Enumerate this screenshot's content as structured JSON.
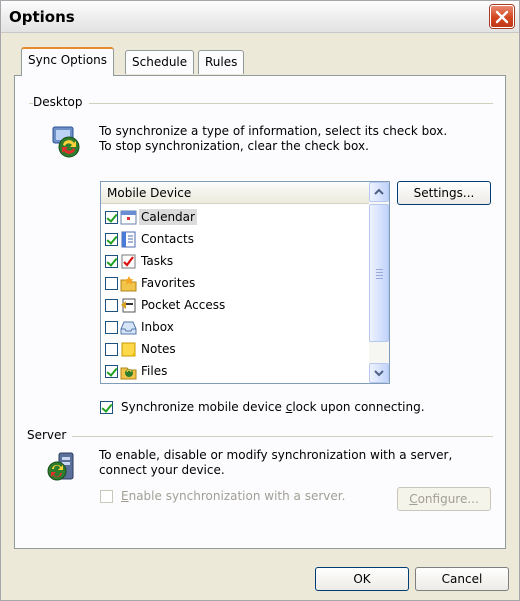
{
  "window": {
    "title": "Options"
  },
  "tabs": [
    {
      "label": "Sync Options",
      "active": true
    },
    {
      "label": "Schedule",
      "active": false
    },
    {
      "label": "Rules",
      "active": false
    }
  ],
  "desktop": {
    "group_label": "Desktop",
    "desc_line1": "To synchronize a type of information, select its check box.",
    "desc_line2": "To stop synchronization, clear the check box.",
    "list_header": "Mobile Device",
    "items": [
      {
        "label": "Calendar",
        "checked": true,
        "icon": "calendar-icon",
        "selected": true
      },
      {
        "label": "Contacts",
        "checked": true,
        "icon": "contacts-icon",
        "selected": false
      },
      {
        "label": "Tasks",
        "checked": true,
        "icon": "tasks-icon",
        "selected": false
      },
      {
        "label": "Favorites",
        "checked": false,
        "icon": "favorites-icon",
        "selected": false
      },
      {
        "label": "Pocket Access",
        "checked": false,
        "icon": "pocket-access-icon",
        "selected": false
      },
      {
        "label": "Inbox",
        "checked": false,
        "icon": "inbox-icon",
        "selected": false
      },
      {
        "label": "Notes",
        "checked": false,
        "icon": "notes-icon",
        "selected": false
      },
      {
        "label": "Files",
        "checked": true,
        "icon": "files-icon",
        "selected": false
      }
    ],
    "settings_button": "Settings...",
    "sync_clock_pre": "Synchronize mobile device ",
    "sync_clock_u": "c",
    "sync_clock_post": "lock upon connecting.",
    "sync_clock_checked": true
  },
  "server": {
    "group_label": "Server",
    "desc_line1": "To enable, disable or modify synchronization with a server,",
    "desc_line2": "connect your device.",
    "enable_u": "E",
    "enable_post": "nable synchronization with a server.",
    "configure_u": "C",
    "configure_post": "onfigure..."
  },
  "footer": {
    "ok": "OK",
    "cancel": "Cancel"
  },
  "colors": {
    "accent": "#e68b2c",
    "close": "#d2461e",
    "border": "#003c74"
  }
}
